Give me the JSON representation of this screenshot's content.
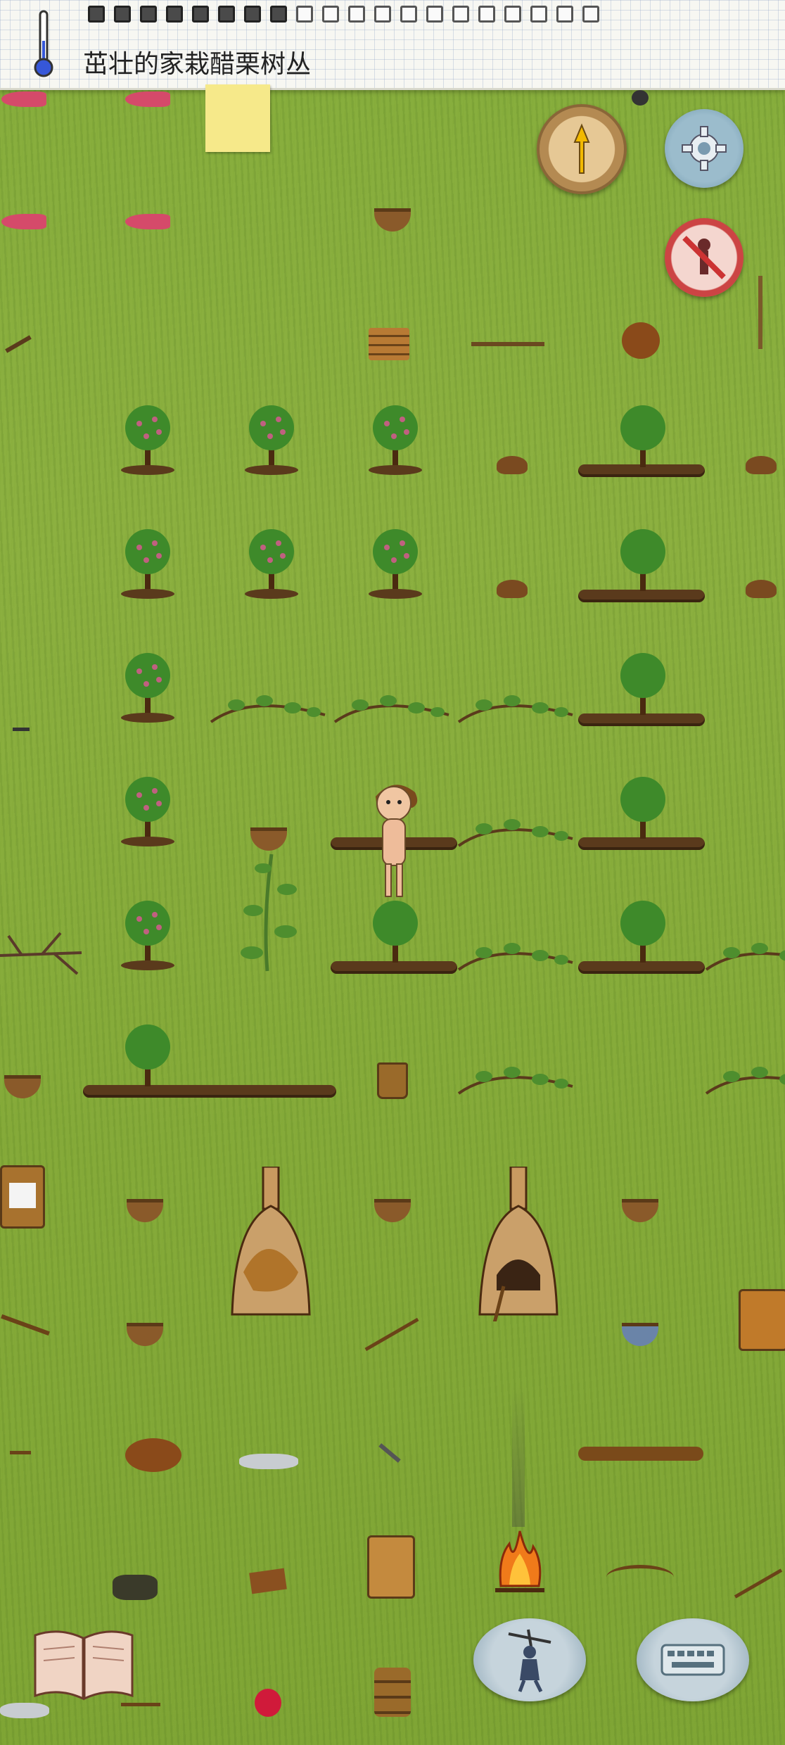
{
  "hud": {
    "biome_label": "茁壮的家栽醋栗树丛",
    "hunger_slots_total": 20,
    "hunger_slots_full": 8
  },
  "buttons": {
    "compass": "compass-icon",
    "settings": "gear-icon",
    "no_kill": "no-kill-icon",
    "tech_book": "book-icon",
    "emote": "puppet-icon",
    "chat": "keyboard-icon"
  },
  "colors": {
    "grass": "#86ad3c",
    "furrow": "#5a3a1c",
    "bush_leaf": "#3e8a2a",
    "berry": "#c06080"
  }
}
